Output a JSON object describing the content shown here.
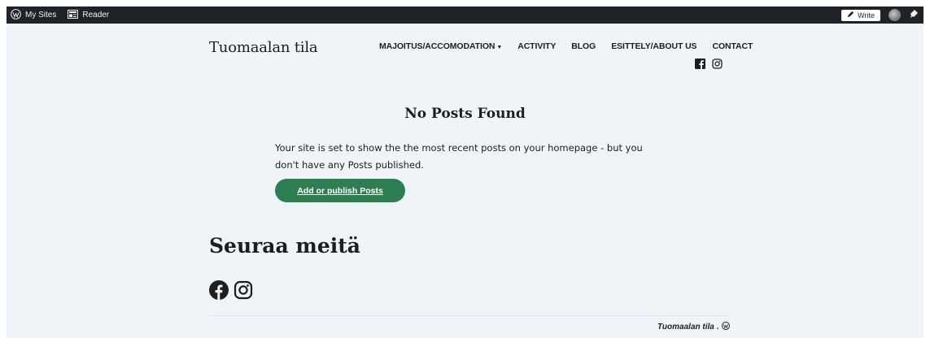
{
  "admin_bar": {
    "my_sites_label": "My Sites",
    "reader_label": "Reader",
    "write_label": "Write",
    "icons": [
      "wordpress-icon",
      "reader-icon",
      "pen-icon",
      "avatar",
      "notifications-icon"
    ]
  },
  "header": {
    "site_title": "Tuomaalan tila",
    "nav": [
      {
        "label": "MAJOITUS/ACCOMODATION",
        "dropdown": true
      },
      {
        "label": "ACTIVITY",
        "dropdown": false
      },
      {
        "label": "BLOG",
        "dropdown": false
      },
      {
        "label": "ESITTELY/ABOUT US",
        "dropdown": false
      },
      {
        "label": "CONTACT",
        "dropdown": false
      }
    ],
    "social_icons": [
      "facebook-icon",
      "instagram-icon"
    ]
  },
  "main": {
    "heading": "No Posts Found",
    "description": "Your site is set to show the the most recent posts on your homepage - but you don't have any Posts published.",
    "button_label": "Add or publish Posts"
  },
  "follow": {
    "heading": "Seuraa meitä",
    "social_icons": [
      "facebook-icon",
      "instagram-icon"
    ]
  },
  "footer": {
    "site_name": "Tuomaalan tila",
    "separator": "."
  },
  "colors": {
    "admin_bar_bg": "#1d2327",
    "page_bg": "#eef4f7",
    "button_bg": "#2f7d52",
    "text": "#1e1e1e"
  }
}
